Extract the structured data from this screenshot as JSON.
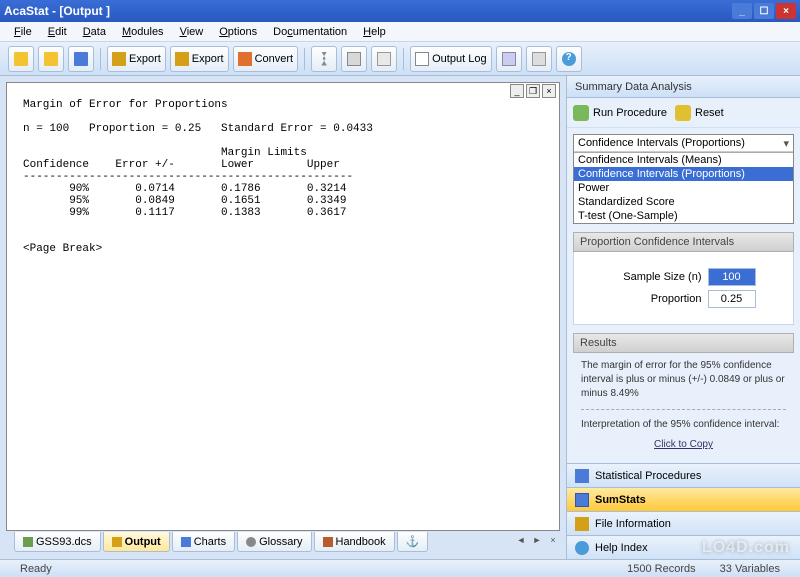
{
  "window": {
    "title": "AcaStat - [Output    ]"
  },
  "menu": {
    "file": "File",
    "edit": "Edit",
    "data": "Data",
    "modules": "Modules",
    "view": "View",
    "options": "Options",
    "documentation": "Documentation",
    "help": "Help"
  },
  "toolbar": {
    "export1": "Export",
    "export2": "Export",
    "convert": "Convert",
    "outputlog": "Output Log"
  },
  "output_text": "Margin of Error for Proportions\n\nn = 100   Proportion = 0.25   Standard Error = 0.0433\n\n                              Margin Limits\nConfidence    Error +/-       Lower        Upper\n--------------------------------------------------\n       90%       0.0714       0.1786       0.3214\n       95%       0.0849       0.1651       0.3349\n       99%       0.1117       0.1383       0.3617\n\n\n<Page Break>",
  "doc_tabs": {
    "data": "GSS93.dcs",
    "output": "Output",
    "charts": "Charts",
    "glossary": "Glossary",
    "handbook": "Handbook"
  },
  "side": {
    "title": "Summary Data Analysis",
    "run": "Run Procedure",
    "reset": "Reset",
    "combo_selected": "Confidence Intervals (Proportions)",
    "combo_items": [
      "Confidence Intervals (Means)",
      "Confidence Intervals (Proportions)",
      "Power",
      "Standardized Score",
      "T-test (One-Sample)"
    ],
    "section_ci": "Proportion Confidence Intervals",
    "sample_label": "Sample Size (n)",
    "sample_val": "100",
    "proportion_label": "Proportion",
    "proportion_val": "0.25",
    "results_title": "Results",
    "results1": "The margin of error for the 95% confidence interval is plus or minus (+/-) 0.0849  or plus or minus 8.49%",
    "results2": "Interpretation of the 95% confidence interval:",
    "copy": "Click to Copy"
  },
  "side_nav": {
    "stat": "Statistical Procedures",
    "sum": "SumStats",
    "file": "File Information",
    "help": "Help Index"
  },
  "status": {
    "ready": "Ready",
    "records": "1500 Records",
    "vars": "33 Variables"
  },
  "watermark": "LO4D.com"
}
